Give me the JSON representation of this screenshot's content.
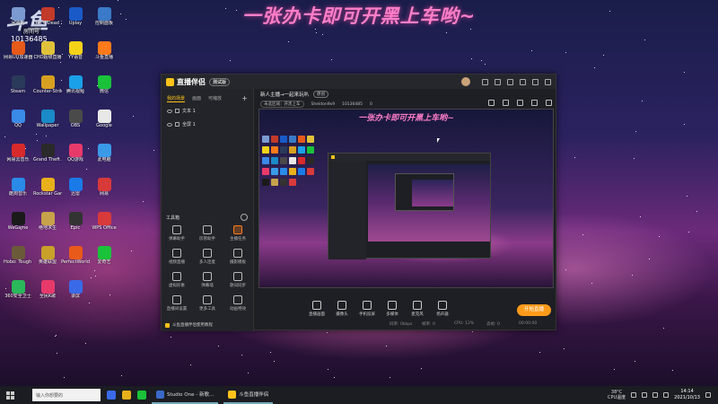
{
  "overlay": {
    "banner": "一张办卡即可开黑上车哟~",
    "logo_text": "斗鱼",
    "logo_sub": "房间号",
    "room_no": "10136485"
  },
  "desktop_icons": [
    {
      "label": "回收站",
      "color": "#7a9ad0"
    },
    {
      "label": "Left 4 Dead 2",
      "color": "#c23a2a"
    },
    {
      "label": "Uplay",
      "color": "#1a5ac8"
    },
    {
      "label": "控制面板",
      "color": "#3a7ac8"
    },
    {
      "label": "网易UU加速器",
      "color": "#e65a1a"
    },
    {
      "label": "CHD超级直播",
      "color": "#e0c23a"
    },
    {
      "label": "YY语音",
      "color": "#f5d21a"
    },
    {
      "label": "斗鱼直播",
      "color": "#ff7a1a"
    },
    {
      "label": "Steam",
      "color": "#2a3a5a"
    },
    {
      "label": "Counter-Strike Global Of...",
      "color": "#d8a020"
    },
    {
      "label": "腾讯视频",
      "color": "#1aa0e8"
    },
    {
      "label": "微信",
      "color": "#1ac23a"
    },
    {
      "label": "QQ",
      "color": "#3a8ae8"
    },
    {
      "label": "Wallpaper",
      "color": "#1a8ac8"
    },
    {
      "label": "OBS",
      "color": "#4a4a4a"
    },
    {
      "label": "Google",
      "color": "#e8e8e8"
    },
    {
      "label": "网易云音乐",
      "color": "#d82a2a"
    },
    {
      "label": "Grand Theft Auto V",
      "color": "#2a2a2a"
    },
    {
      "label": "QQ游戏",
      "color": "#e83a6a"
    },
    {
      "label": "此电脑",
      "color": "#3a9ae8"
    },
    {
      "label": "酷狗音乐",
      "color": "#2a8ae8"
    },
    {
      "label": "Rockstar Games...",
      "color": "#e8b01a"
    },
    {
      "label": "迅雷",
      "color": "#1a7ae8"
    },
    {
      "label": "网易",
      "color": "#d83a3a"
    },
    {
      "label": "WeGame",
      "color": "#1a1a1a"
    },
    {
      "label": "绝地求生",
      "color": "#c8a24a"
    },
    {
      "label": "Epic",
      "color": "#333333"
    },
    {
      "label": "WPS Office",
      "color": "#d83a3a"
    },
    {
      "label": "Hobo: Tough Life",
      "color": "#6a5a3a"
    },
    {
      "label": "英雄联盟",
      "color": "#c8a02a"
    },
    {
      "label": "PerfectWorld",
      "color": "#e85a1a"
    },
    {
      "label": "爱奇艺",
      "color": "#1ac23a"
    },
    {
      "label": "360安全卫士",
      "color": "#2ab85a"
    },
    {
      "label": "全民K歌",
      "color": "#e83a6a"
    },
    {
      "label": "录屏",
      "color": "#3a6ae8"
    }
  ],
  "app": {
    "title": "直播伴侣",
    "beta": "测试版",
    "left_tabs": [
      "我的场景",
      "画面",
      "可缩放"
    ],
    "scenes": [
      "文本 1",
      "全屏 1"
    ],
    "tools_heading": "工具箱",
    "tools": [
      "弹幕助手",
      "房管助手",
      "主播任务",
      "视频直播",
      "多人连麦",
      "摄影模板",
      "虚拟形象",
      "弹幕墙",
      "歌词同步",
      "直播间设置",
      "更多工具",
      "动画特效"
    ],
    "footer": "斗鱼直播伴侣使用教程",
    "stream_title": "新人主播→一起来玩叭",
    "category_tag": "原创",
    "info_row": [
      "未选区域：开黑上车",
      "Sheldon9x9",
      "10136485",
      "0"
    ],
    "preview_banner": "一张办卡即可开黑上车哟~",
    "bottom_buttons": [
      "直播画面",
      "摄像头",
      "手机投屏",
      "多媒体",
      "麦克风",
      "扬声器"
    ],
    "stats": [
      "码率: 0kbps",
      "帧率: 0",
      "CPU: 12%",
      "丢帧: 0",
      "00:00:00"
    ],
    "go_live": "开始直播"
  },
  "taskbar": {
    "search_placeholder": "输入你想要的",
    "apps": [
      {
        "label": "Studio One - 新歌...",
        "color": "#3a6ac8"
      },
      {
        "label": "斗鱼直播伴侣",
        "color": "#ffc21a"
      }
    ],
    "weather": "38°C",
    "weather_sub": "CPU温度",
    "time": "14:14",
    "date": "2021/10/13"
  }
}
